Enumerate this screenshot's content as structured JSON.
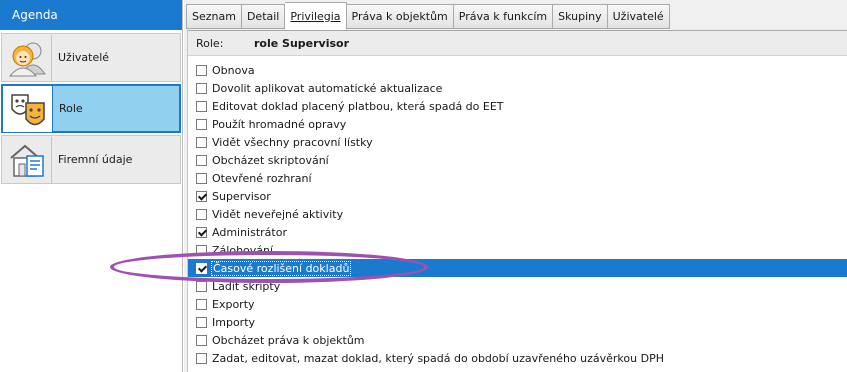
{
  "sidebar": {
    "header": "Agenda",
    "items": [
      {
        "label": "Uživatelé",
        "icon": "users-icon",
        "active": false
      },
      {
        "label": "Role",
        "icon": "role-masks-icon",
        "active": true
      },
      {
        "label": "Firemní údaje",
        "icon": "company-icon",
        "active": false
      }
    ]
  },
  "tabs": [
    {
      "label": "Seznam",
      "active": false
    },
    {
      "label": "Detail",
      "active": false
    },
    {
      "label": "Privilegia",
      "active": true
    },
    {
      "label": "Práva k objektům",
      "active": false
    },
    {
      "label": "Práva k funkcím",
      "active": false
    },
    {
      "label": "Skupiny",
      "active": false
    },
    {
      "label": "Uživatelé",
      "active": false
    }
  ],
  "role": {
    "label": "Role:",
    "value": "role Supervisor"
  },
  "privileges": [
    {
      "label": "Obnova",
      "checked": false,
      "selected": false
    },
    {
      "label": "Dovolit aplikovat automatické aktualizace",
      "checked": false,
      "selected": false
    },
    {
      "label": "Editovat doklad placený platbou, která spadá do EET",
      "checked": false,
      "selected": false
    },
    {
      "label": "Použít hromadné opravy",
      "checked": false,
      "selected": false
    },
    {
      "label": "Vidět všechny pracovní lístky",
      "checked": false,
      "selected": false
    },
    {
      "label": "Obcházet skriptování",
      "checked": false,
      "selected": false
    },
    {
      "label": "Otevřené rozhraní",
      "checked": false,
      "selected": false
    },
    {
      "label": "Supervisor",
      "checked": true,
      "selected": false
    },
    {
      "label": "Vidět neveřejné aktivity",
      "checked": false,
      "selected": false
    },
    {
      "label": "Administrátor",
      "checked": true,
      "selected": false
    },
    {
      "label": "Zálohování",
      "checked": false,
      "selected": false
    },
    {
      "label": "Časové rozlišení dokladů",
      "checked": true,
      "selected": true
    },
    {
      "label": "Ladit skripty",
      "checked": false,
      "selected": false
    },
    {
      "label": "Exporty",
      "checked": false,
      "selected": false
    },
    {
      "label": "Importy",
      "checked": false,
      "selected": false
    },
    {
      "label": "Obcházet práva k objektům",
      "checked": false,
      "selected": false
    },
    {
      "label": "Zadat, editovat, mazat doklad, který spadá do období uzavřeného uzávěrkou DPH",
      "checked": false,
      "selected": false
    }
  ],
  "colors": {
    "accent": "#1a7ad0",
    "active_nav": "#92d0f0",
    "annotation": "#a050b0"
  }
}
